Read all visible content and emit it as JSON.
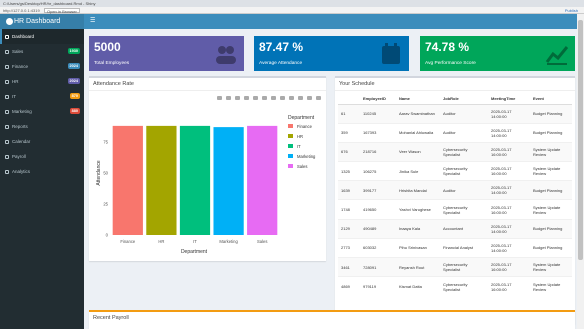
{
  "browser": {
    "title": "C:/Users/gs/Desktop/HR/hr_dashboard.Rmd - Shiny",
    "url": "http://127.0.0.1:4319",
    "open_in_browser": "Open in Browser",
    "publish": "Publish"
  },
  "app": {
    "title": "HR Dashboard"
  },
  "sidebar": {
    "items": [
      {
        "label": "Dashboard",
        "badge": "",
        "badge_color": ""
      },
      {
        "label": "Sales",
        "badge": "1930",
        "badge_color": "#00a65a"
      },
      {
        "label": "Finance",
        "badge": "2024",
        "badge_color": "#3c8dbc"
      },
      {
        "label": "HR",
        "badge": "2024",
        "badge_color": "#605ca8"
      },
      {
        "label": "IT",
        "badge": "870",
        "badge_color": "#f39c12"
      },
      {
        "label": "Marketing",
        "badge": "880",
        "badge_color": "#dd4b39"
      },
      {
        "label": "Reports",
        "badge": "",
        "badge_color": ""
      },
      {
        "label": "Calendar",
        "badge": "",
        "badge_color": ""
      },
      {
        "label": "Payroll",
        "badge": "",
        "badge_color": ""
      },
      {
        "label": "Analytics",
        "badge": "",
        "badge_color": ""
      }
    ]
  },
  "kpis": [
    {
      "value": "5000",
      "label": "Total Employees",
      "color": "#605ca8",
      "icon": "users-icon"
    },
    {
      "value": "87.47 %",
      "label": "Average Attendance",
      "color": "#0073b7",
      "icon": "calendar-check-icon"
    },
    {
      "value": "74.78 %",
      "label": "Avg Performance Score",
      "color": "#00a65a",
      "icon": "line-chart-icon"
    }
  ],
  "attendance_box": {
    "title": "Attendance Rate"
  },
  "chart_data": {
    "type": "bar",
    "categories": [
      "Finance",
      "HR",
      "IT",
      "Marketing",
      "Sales"
    ],
    "values": [
      88,
      88,
      88,
      87,
      88
    ],
    "colors": [
      "#f8766d",
      "#a3a500",
      "#00bf7d",
      "#00b0f6",
      "#e76bf3"
    ],
    "xlabel": "Department",
    "ylabel": "Attendance",
    "ylim": [
      0,
      100
    ],
    "yticks": [
      0,
      25,
      50,
      75
    ],
    "legend_title": "Department",
    "legend_position": "right",
    "grid": false
  },
  "schedule": {
    "title": "Your Schedule",
    "columns": [
      "",
      "EmployeeID",
      "Name",
      "JobRole",
      "MeetingTime",
      "Event"
    ],
    "rows": [
      [
        "61",
        "110245",
        "Aarav Swaminathan",
        "Auditor",
        "2025-03-17 14:00:00",
        "Budget Planning"
      ],
      [
        "359",
        "167393",
        "Mohanlal Ahluwalia",
        "Auditor",
        "2025-03-17 14:00:00",
        "Budget Planning"
      ],
      [
        "676",
        "218716",
        "Veer Wason",
        "Cybersecurity Specialist",
        "2025-03-17 16:00:00",
        "System Update Review"
      ],
      [
        "1325",
        "106275",
        "Jinika Sule",
        "Cybersecurity Specialist",
        "2025-03-17 16:00:00",
        "System Update Review"
      ],
      [
        "1639",
        "399177",
        "Hrishita Mandal",
        "Auditor",
        "2025-03-17 14:00:00",
        "Budget Planning"
      ],
      [
        "1748",
        "419650",
        "Yashvi Varughese",
        "Cybersecurity Specialist",
        "2025-03-17 16:00:00",
        "System Update Review"
      ],
      [
        "2129",
        "490489",
        "Inaaya Kala",
        "Accountant",
        "2025-03-17 14:00:00",
        "Budget Planning"
      ],
      [
        "2773",
        "603032",
        "Pihu Srinivasan",
        "Financial Analyst",
        "2025-03-17 14:00:00",
        "Budget Planning"
      ],
      [
        "3461",
        "728091",
        "Reyansh Rout",
        "Cybersecurity Specialist",
        "2025-03-17 16:00:00",
        "System Update Review"
      ],
      [
        "4869",
        "979119",
        "Kismat Datta",
        "Cybersecurity Specialist",
        "2025-03-17 16:00:00",
        "System Update Review"
      ]
    ]
  },
  "payroll": {
    "title": "Recent Payroll"
  }
}
